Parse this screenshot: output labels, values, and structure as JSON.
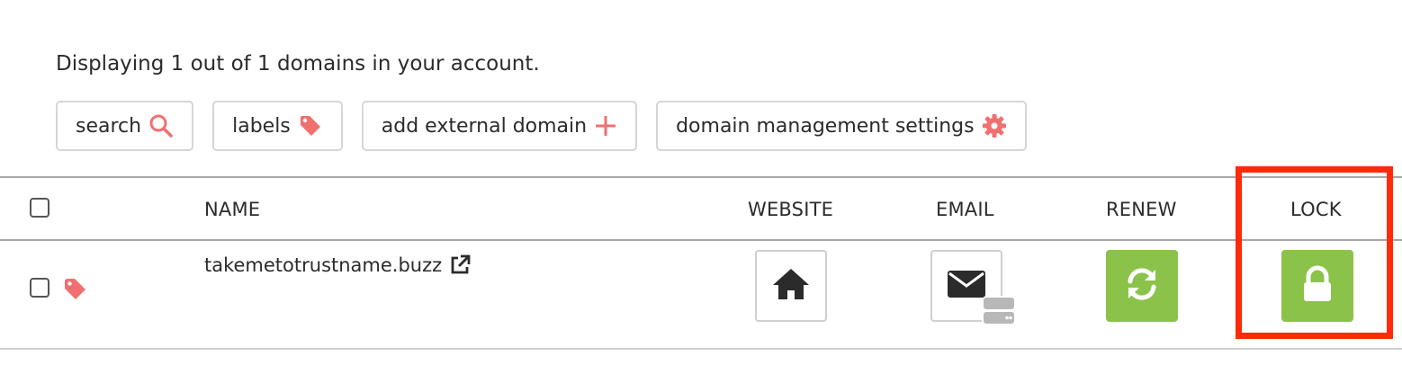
{
  "summary": "Displaying 1 out of 1 domains in your account.",
  "toolbar": {
    "search": "search",
    "labels": "labels",
    "add_external": "add external domain",
    "settings": "domain management settings"
  },
  "table": {
    "headers": {
      "name": "NAME",
      "website": "WEBSITE",
      "email": "EMAIL",
      "renew": "RENEW",
      "lock": "LOCK"
    },
    "rows": [
      {
        "domain": "takemetotrustname.buzz"
      }
    ]
  },
  "colors": {
    "accent": "#f07070",
    "green": "#8bc34a",
    "highlight": "#ff2a0a"
  },
  "icons": [
    "search-icon",
    "tag-icon",
    "plus-icon",
    "gear-icon",
    "external-link-icon",
    "home-icon",
    "envelope-icon",
    "server-icon",
    "refresh-icon",
    "lock-icon"
  ]
}
